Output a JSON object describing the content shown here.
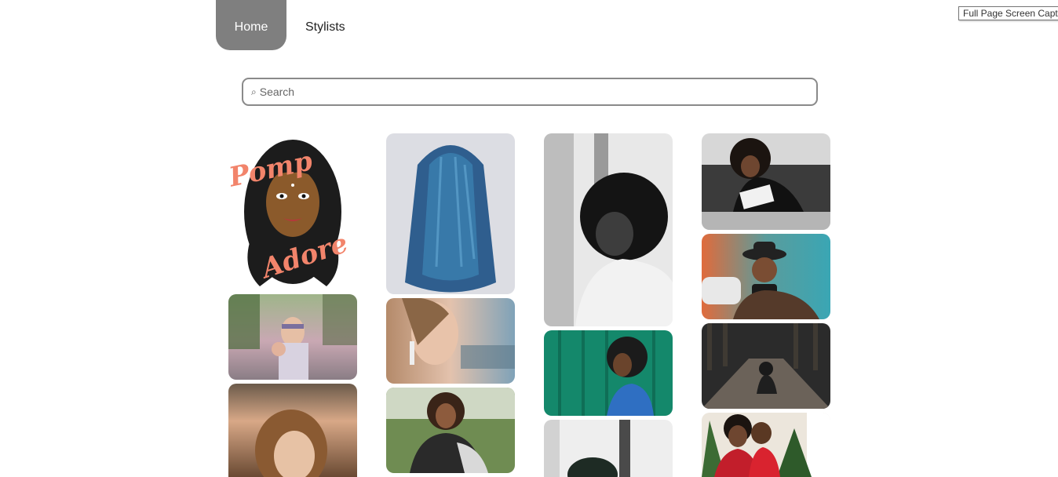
{
  "nav": {
    "home_label": "Home",
    "stylists_label": "Stylists"
  },
  "tooltip": {
    "text": "Full Page Screen Capture"
  },
  "search": {
    "placeholder": "Search",
    "value": ""
  },
  "gallery": {
    "logo_text_top": "Pomp",
    "logo_text_bottom": "Adore"
  },
  "colors": {
    "nav_active_bg": "#7f7f7f",
    "logo_accent": "#f2846b"
  }
}
